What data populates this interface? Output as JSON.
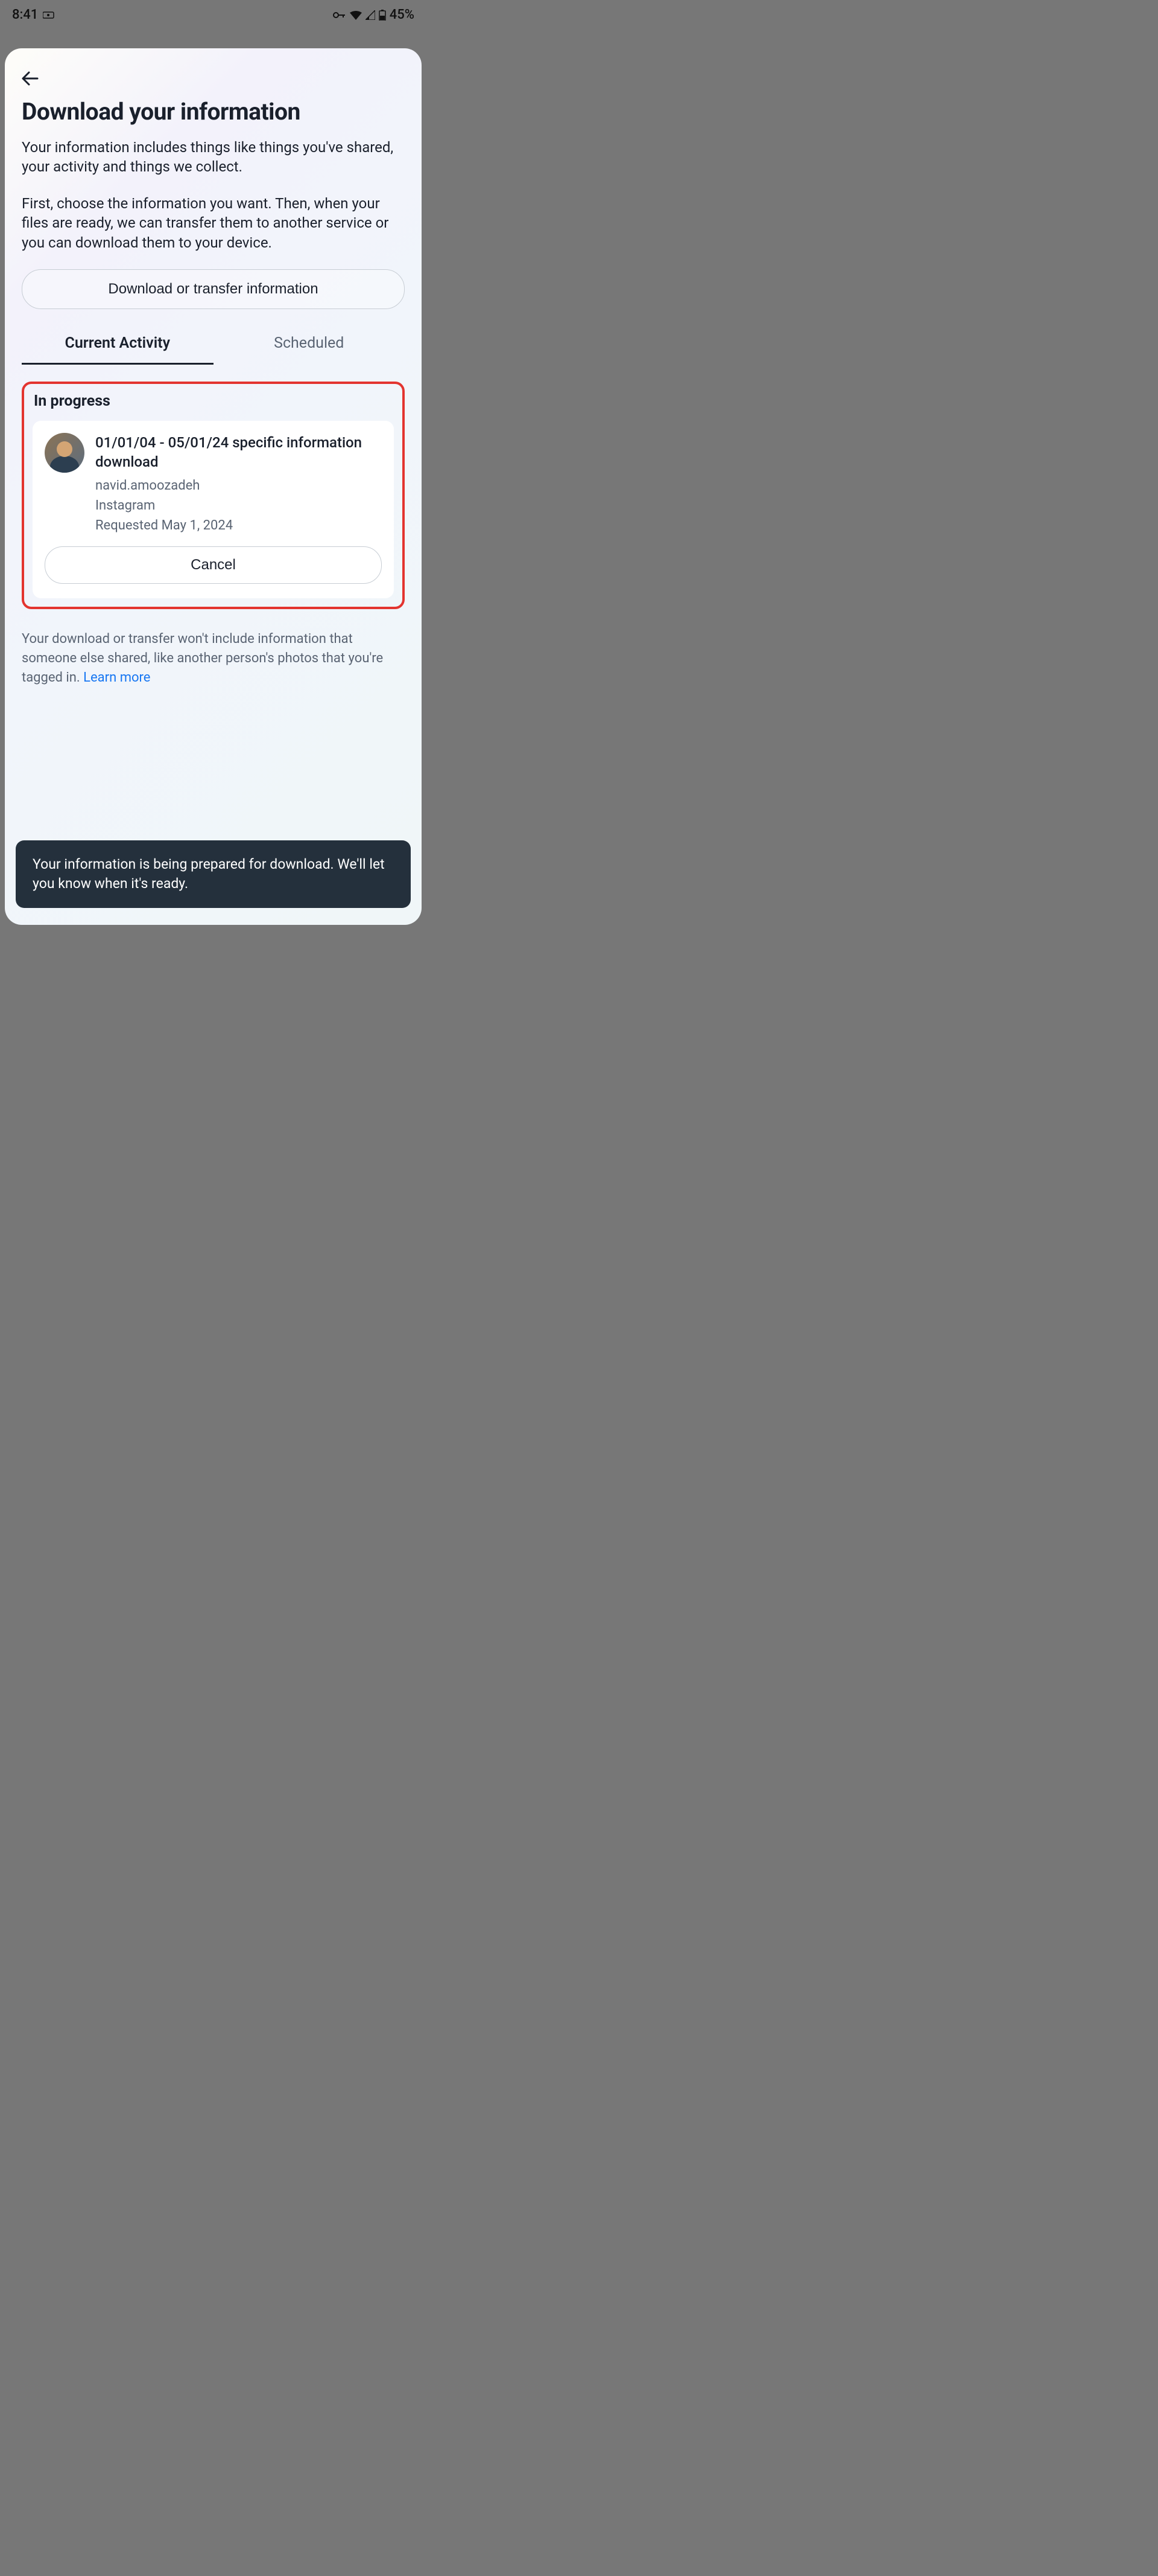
{
  "statusbar": {
    "time": "8:41",
    "battery_percent": "45%"
  },
  "header": {
    "title": "Download your information",
    "description1": "Your information includes things like things you've shared, your activity and things we collect.",
    "description2": "First, choose the information you want. Then, when your files are ready, we can transfer them to another service or you can download them to your device."
  },
  "primary_action": {
    "label": "Download or transfer information"
  },
  "tabs": {
    "current": "Current Activity",
    "scheduled": "Scheduled"
  },
  "section": {
    "heading": "In progress"
  },
  "download_item": {
    "title": "01/01/04 - 05/01/24 specific information download",
    "username": "navid.amoozadeh",
    "platform": "Instagram",
    "requested": "Requested May 1, 2024",
    "cancel_label": "Cancel"
  },
  "footer": {
    "text": "Your download or transfer won't include information that someone else shared, like another person's photos that you're tagged in. ",
    "learn_more": "Learn more"
  },
  "toast": {
    "message": "Your information is being prepared for download. We'll let you know when it's ready."
  }
}
